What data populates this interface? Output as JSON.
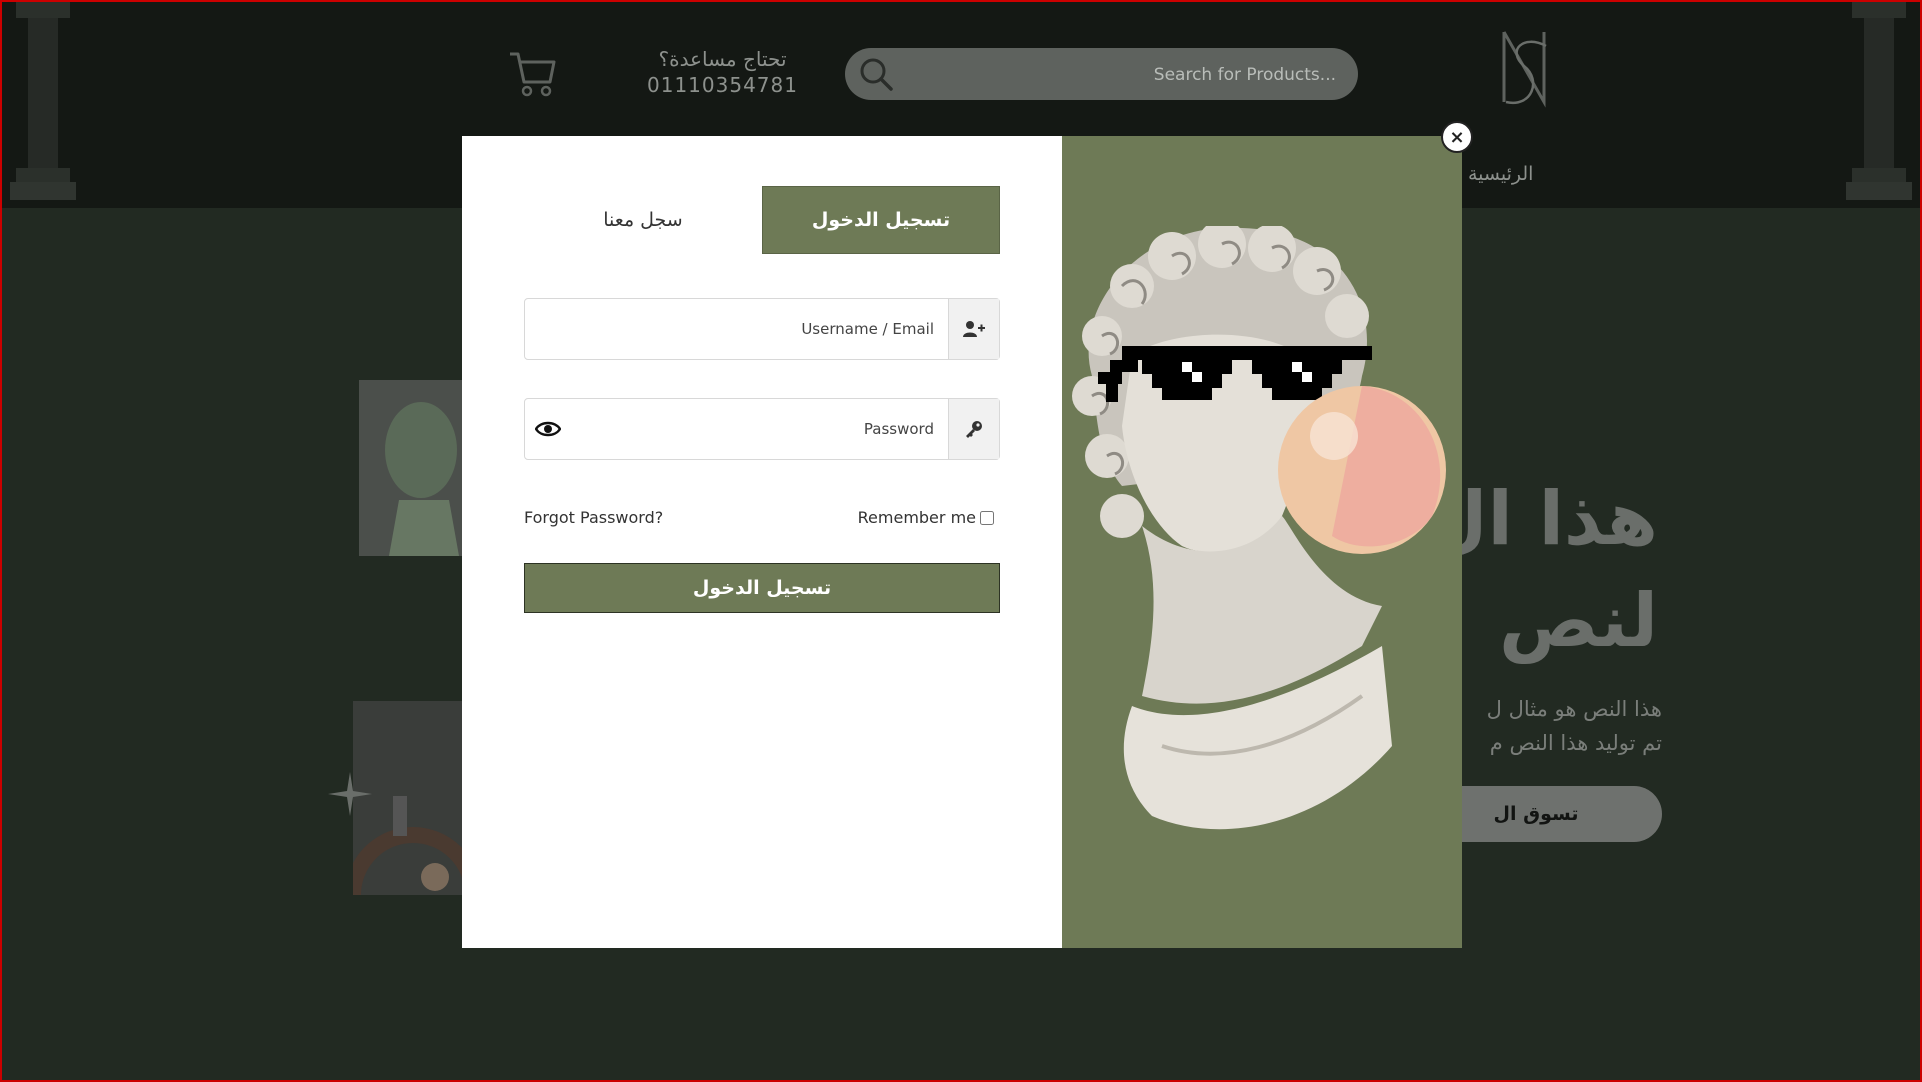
{
  "header": {
    "search": {
      "placeholder": "Search for Products..."
    },
    "help": {
      "line1": "تحتاج مساعدة؟",
      "phone": "01110354781"
    },
    "nav": {
      "home": "الرئيسية"
    }
  },
  "hero": {
    "title_line1": "هذا ال",
    "title_line2": "لنص",
    "text_line1": "هذا النص هو مثال ل",
    "text_line2": "تم توليد هذا النص م",
    "button": "تسوق ال"
  },
  "modal": {
    "close": "×",
    "tabs": {
      "login": "تسجيل الدخول",
      "register": "سجل معنا"
    },
    "username": {
      "placeholder": "Username / Email"
    },
    "password": {
      "placeholder": "Password"
    },
    "remember": "Remember me",
    "forgot": "Forgot Password?",
    "submit": "تسجيل الدخول"
  },
  "colors": {
    "accent": "#6e7a56",
    "page_bg": "#222a22",
    "header_bg": "#141814"
  }
}
